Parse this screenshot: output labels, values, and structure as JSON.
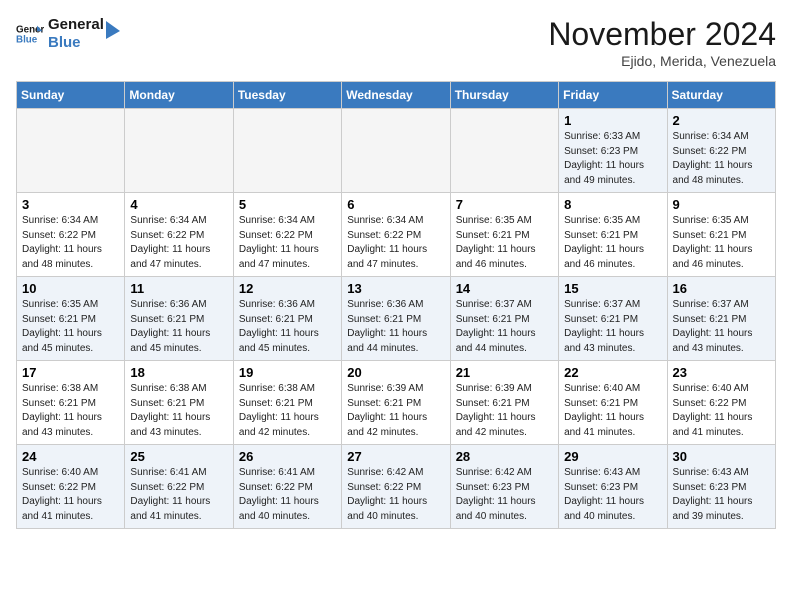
{
  "header": {
    "logo_general": "General",
    "logo_blue": "Blue",
    "month_title": "November 2024",
    "location": "Ejido, Merida, Venezuela"
  },
  "weekdays": [
    "Sunday",
    "Monday",
    "Tuesday",
    "Wednesday",
    "Thursday",
    "Friday",
    "Saturday"
  ],
  "weeks": [
    [
      {
        "day": "",
        "info": ""
      },
      {
        "day": "",
        "info": ""
      },
      {
        "day": "",
        "info": ""
      },
      {
        "day": "",
        "info": ""
      },
      {
        "day": "",
        "info": ""
      },
      {
        "day": "1",
        "info": "Sunrise: 6:33 AM\nSunset: 6:23 PM\nDaylight: 11 hours\nand 49 minutes."
      },
      {
        "day": "2",
        "info": "Sunrise: 6:34 AM\nSunset: 6:22 PM\nDaylight: 11 hours\nand 48 minutes."
      }
    ],
    [
      {
        "day": "3",
        "info": "Sunrise: 6:34 AM\nSunset: 6:22 PM\nDaylight: 11 hours\nand 48 minutes."
      },
      {
        "day": "4",
        "info": "Sunrise: 6:34 AM\nSunset: 6:22 PM\nDaylight: 11 hours\nand 47 minutes."
      },
      {
        "day": "5",
        "info": "Sunrise: 6:34 AM\nSunset: 6:22 PM\nDaylight: 11 hours\nand 47 minutes."
      },
      {
        "day": "6",
        "info": "Sunrise: 6:34 AM\nSunset: 6:22 PM\nDaylight: 11 hours\nand 47 minutes."
      },
      {
        "day": "7",
        "info": "Sunrise: 6:35 AM\nSunset: 6:21 PM\nDaylight: 11 hours\nand 46 minutes."
      },
      {
        "day": "8",
        "info": "Sunrise: 6:35 AM\nSunset: 6:21 PM\nDaylight: 11 hours\nand 46 minutes."
      },
      {
        "day": "9",
        "info": "Sunrise: 6:35 AM\nSunset: 6:21 PM\nDaylight: 11 hours\nand 46 minutes."
      }
    ],
    [
      {
        "day": "10",
        "info": "Sunrise: 6:35 AM\nSunset: 6:21 PM\nDaylight: 11 hours\nand 45 minutes."
      },
      {
        "day": "11",
        "info": "Sunrise: 6:36 AM\nSunset: 6:21 PM\nDaylight: 11 hours\nand 45 minutes."
      },
      {
        "day": "12",
        "info": "Sunrise: 6:36 AM\nSunset: 6:21 PM\nDaylight: 11 hours\nand 45 minutes."
      },
      {
        "day": "13",
        "info": "Sunrise: 6:36 AM\nSunset: 6:21 PM\nDaylight: 11 hours\nand 44 minutes."
      },
      {
        "day": "14",
        "info": "Sunrise: 6:37 AM\nSunset: 6:21 PM\nDaylight: 11 hours\nand 44 minutes."
      },
      {
        "day": "15",
        "info": "Sunrise: 6:37 AM\nSunset: 6:21 PM\nDaylight: 11 hours\nand 43 minutes."
      },
      {
        "day": "16",
        "info": "Sunrise: 6:37 AM\nSunset: 6:21 PM\nDaylight: 11 hours\nand 43 minutes."
      }
    ],
    [
      {
        "day": "17",
        "info": "Sunrise: 6:38 AM\nSunset: 6:21 PM\nDaylight: 11 hours\nand 43 minutes."
      },
      {
        "day": "18",
        "info": "Sunrise: 6:38 AM\nSunset: 6:21 PM\nDaylight: 11 hours\nand 43 minutes."
      },
      {
        "day": "19",
        "info": "Sunrise: 6:38 AM\nSunset: 6:21 PM\nDaylight: 11 hours\nand 42 minutes."
      },
      {
        "day": "20",
        "info": "Sunrise: 6:39 AM\nSunset: 6:21 PM\nDaylight: 11 hours\nand 42 minutes."
      },
      {
        "day": "21",
        "info": "Sunrise: 6:39 AM\nSunset: 6:21 PM\nDaylight: 11 hours\nand 42 minutes."
      },
      {
        "day": "22",
        "info": "Sunrise: 6:40 AM\nSunset: 6:21 PM\nDaylight: 11 hours\nand 41 minutes."
      },
      {
        "day": "23",
        "info": "Sunrise: 6:40 AM\nSunset: 6:22 PM\nDaylight: 11 hours\nand 41 minutes."
      }
    ],
    [
      {
        "day": "24",
        "info": "Sunrise: 6:40 AM\nSunset: 6:22 PM\nDaylight: 11 hours\nand 41 minutes."
      },
      {
        "day": "25",
        "info": "Sunrise: 6:41 AM\nSunset: 6:22 PM\nDaylight: 11 hours\nand 41 minutes."
      },
      {
        "day": "26",
        "info": "Sunrise: 6:41 AM\nSunset: 6:22 PM\nDaylight: 11 hours\nand 40 minutes."
      },
      {
        "day": "27",
        "info": "Sunrise: 6:42 AM\nSunset: 6:22 PM\nDaylight: 11 hours\nand 40 minutes."
      },
      {
        "day": "28",
        "info": "Sunrise: 6:42 AM\nSunset: 6:23 PM\nDaylight: 11 hours\nand 40 minutes."
      },
      {
        "day": "29",
        "info": "Sunrise: 6:43 AM\nSunset: 6:23 PM\nDaylight: 11 hours\nand 40 minutes."
      },
      {
        "day": "30",
        "info": "Sunrise: 6:43 AM\nSunset: 6:23 PM\nDaylight: 11 hours\nand 39 minutes."
      }
    ]
  ]
}
